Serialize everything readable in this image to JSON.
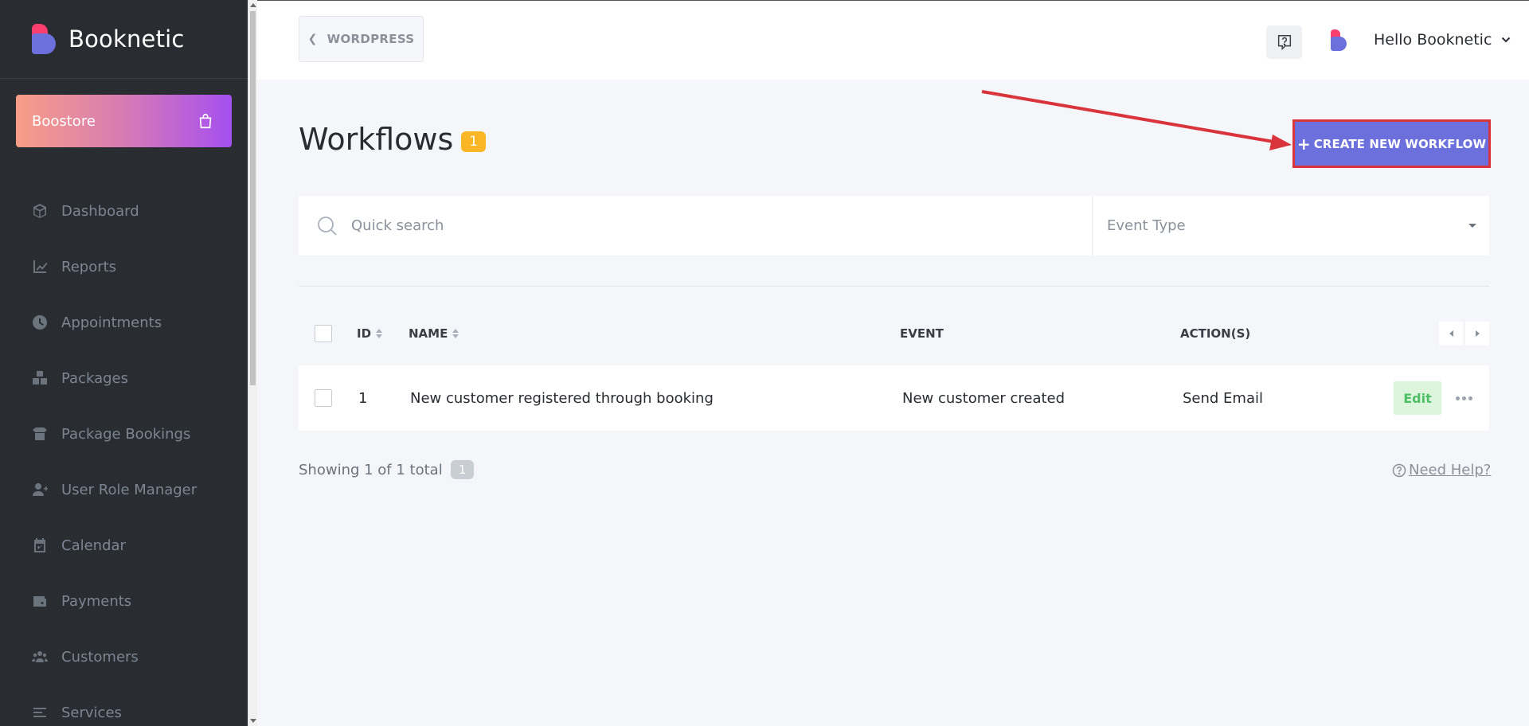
{
  "brand": {
    "name": "Booknetic"
  },
  "boostore": {
    "label": "Boostore"
  },
  "nav": {
    "items": [
      {
        "label": "Dashboard",
        "icon": "cube-icon"
      },
      {
        "label": "Reports",
        "icon": "chart-line-icon"
      },
      {
        "label": "Appointments",
        "icon": "clock-icon"
      },
      {
        "label": "Packages",
        "icon": "cubes-icon"
      },
      {
        "label": "Package Bookings",
        "icon": "box-open-icon"
      },
      {
        "label": "User Role Manager",
        "icon": "user-plus-icon"
      },
      {
        "label": "Calendar",
        "icon": "calendar-check-icon"
      },
      {
        "label": "Payments",
        "icon": "wallet-icon"
      },
      {
        "label": "Customers",
        "icon": "users-icon"
      },
      {
        "label": "Services",
        "icon": "list-icon"
      }
    ]
  },
  "header": {
    "back_label": "WORDPRESS",
    "user_greeting": "Hello Booknetic"
  },
  "page": {
    "title": "Workflows",
    "count": "1",
    "create_label": "CREATE NEW WORKFLOW"
  },
  "filters": {
    "search_placeholder": "Quick search",
    "event_type_label": "Event Type"
  },
  "table": {
    "columns": {
      "id": "ID",
      "name": "NAME",
      "event": "EVENT",
      "actions": "ACTION(S)"
    },
    "rows": [
      {
        "id": "1",
        "name": "New customer registered through booking",
        "event": "New customer created",
        "actions": "Send Email",
        "edit_label": "Edit"
      }
    ]
  },
  "footer": {
    "showing": "Showing 1 of 1 total",
    "total": "1",
    "help_label": "Need Help?"
  },
  "colors": {
    "sidebar": "#292d32",
    "primary": "#6c70dc",
    "badge": "#fbb626",
    "annotation": "#d9343b",
    "edit_bg": "#dcf5dc",
    "edit_text": "#4fbf65"
  }
}
